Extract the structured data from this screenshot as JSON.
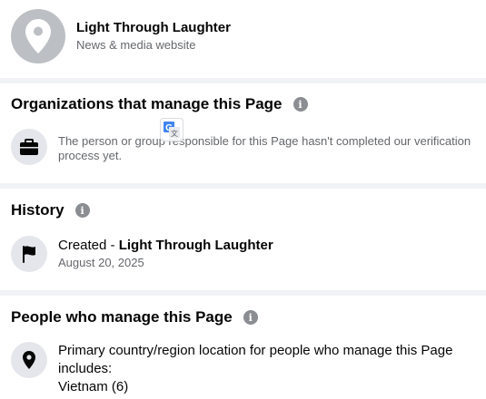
{
  "header": {
    "page_name": "Light Through Laughter",
    "category": "News & media website",
    "avatar_icon": "map-pin-icon"
  },
  "organizations": {
    "title": "Organizations that manage this Page",
    "info_icon": "i",
    "row_icon": "briefcase-icon",
    "text": "The person or group responsible for this Page hasn't completed our verification process yet."
  },
  "history": {
    "title": "History",
    "info_icon": "i",
    "row_icon": "flag-icon",
    "created_prefix": "Created - ",
    "created_name": "Light Through Laughter",
    "date": "August 20, 2025"
  },
  "people": {
    "title": "People who manage this Page",
    "info_icon": "i",
    "row_icon": "location-pin-icon",
    "text": "Primary country/region location for people who manage this Page includes:",
    "location": "Vietnam (6)"
  },
  "translate_badge_icon": "google-translate-icon"
}
